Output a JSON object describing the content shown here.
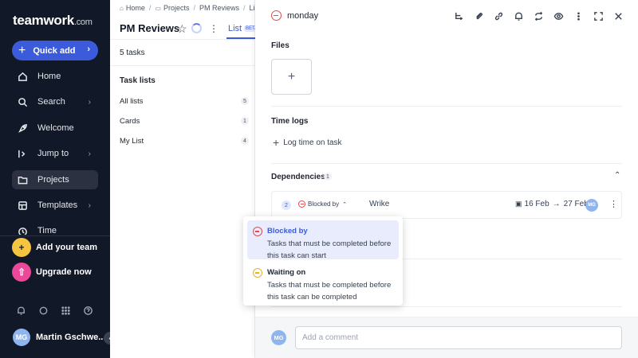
{
  "brand": {
    "logo_main": "teamwork",
    "logo_suffix": ".com"
  },
  "sidebar": {
    "quick_add": "Quick add",
    "items": [
      {
        "label": "Home",
        "icon": "home-icon"
      },
      {
        "label": "Search",
        "icon": "search-icon"
      },
      {
        "label": "Welcome",
        "icon": "rocket-icon"
      },
      {
        "label": "Jump to",
        "icon": "jump-icon"
      },
      {
        "label": "Projects",
        "icon": "folder-icon"
      },
      {
        "label": "Templates",
        "icon": "templates-icon"
      },
      {
        "label": "Time",
        "icon": "clock-icon"
      }
    ],
    "add_team": "Add your team",
    "upgrade": "Upgrade now",
    "user_initials": "MG",
    "user_name": "Martin Gschwe..."
  },
  "project": {
    "breadcrumb": [
      "Home",
      "Projects",
      "PM Reviews",
      "List"
    ],
    "title": "PM Reviews",
    "tab_active": "List",
    "tab_badge": "BETA",
    "task_count": "5 tasks",
    "task_lists_title": "Task lists",
    "task_lists": [
      {
        "name": "All lists",
        "count": "5"
      },
      {
        "name": "Cards",
        "count": "1"
      },
      {
        "name": "My List",
        "count": "4"
      }
    ]
  },
  "task": {
    "name": "monday",
    "files_title": "Files",
    "time_logs_title": "Time logs",
    "log_time_label": "Log time on task",
    "dependencies_title": "Dependencies",
    "dependencies_count": "1",
    "dependency": {
      "number": "2",
      "type": "Blocked by",
      "task": "Wrike",
      "start_date": "16 Feb",
      "end_date": "27 Feb",
      "assignee_initials": "MG"
    },
    "comment_placeholder": "Add a comment",
    "comment_avatar_initials": "MG"
  },
  "dependency_menu": {
    "options": [
      {
        "title": "Blocked by",
        "description": "Tasks that must be completed before this task can start",
        "color": "#e5484d",
        "selected": true
      },
      {
        "title": "Waiting on",
        "description": "Tasks that must be completed before this task can be completed",
        "color": "#e6b325",
        "selected": false
      }
    ]
  },
  "colors": {
    "accent": "#3b5bdb",
    "sidebar_bg": "#111827",
    "blocked": "#e5484d",
    "waiting": "#e6b325"
  }
}
